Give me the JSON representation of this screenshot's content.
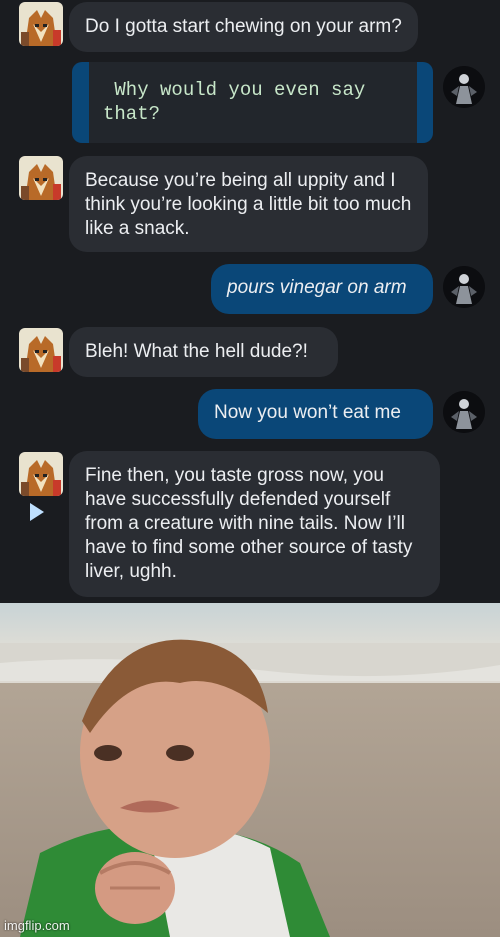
{
  "chat": {
    "messages": [
      {
        "from": "them",
        "text": "Do I gotta start chewing on your arm?"
      },
      {
        "from": "me",
        "style": "code",
        "text": " Why would you even say\nthat?"
      },
      {
        "from": "them",
        "text": "Because you’re being all uppity and I think you’re looking a little bit too much like a snack."
      },
      {
        "from": "me",
        "style": "italic",
        "text": "pours vinegar on arm"
      },
      {
        "from": "them",
        "text": "Bleh! What the hell dude?!"
      },
      {
        "from": "me",
        "text": "Now you won’t eat me"
      },
      {
        "from": "them",
        "text": "Fine then, you taste gross now, you have successfully defended yourself from a creature with nine tails. Now I’ll have to find some other source of tasty liver, ughh."
      }
    ]
  },
  "meme": {
    "watermark": "imgflip.com"
  },
  "colors": {
    "background": "#1a1c20",
    "them_bubble": "#2a2d33",
    "me_bubble": "#0a4778",
    "code_text": "#c7e6c9"
  },
  "icons": [
    "fox-avatar-icon",
    "dark-figure-avatar-icon",
    "play-icon"
  ]
}
